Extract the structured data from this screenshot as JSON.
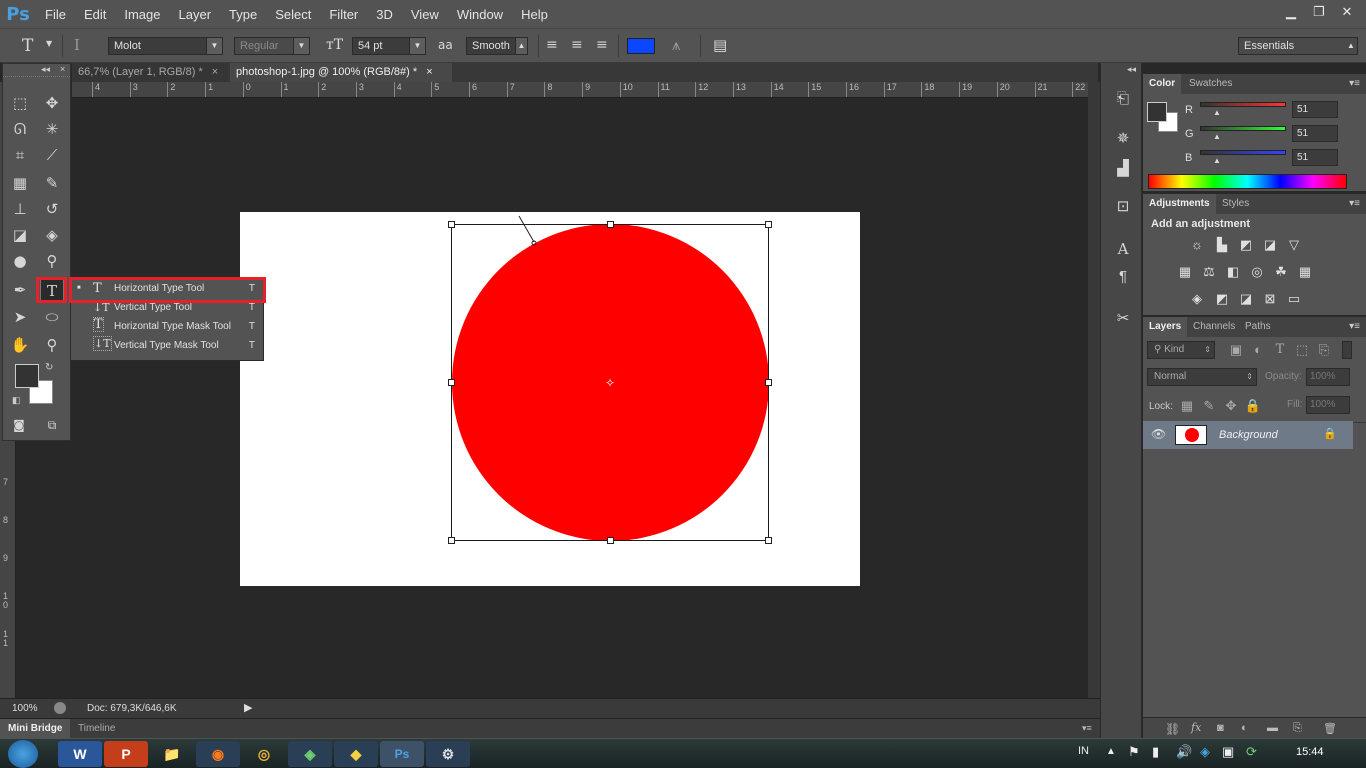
{
  "app": {
    "logo": "Ps"
  },
  "menu": [
    "File",
    "Edit",
    "Image",
    "Layer",
    "Type",
    "Select",
    "Filter",
    "3D",
    "View",
    "Window",
    "Help"
  ],
  "window_controls": {
    "minimize": "▁",
    "restore": "❐",
    "close": "✕"
  },
  "options": {
    "font_family": "Molot",
    "font_style": "Regular",
    "font_size": "54 pt",
    "anti_alias": "Smooth",
    "text_color": "#0a47ff",
    "workspace": "Essentials",
    "aa_label": "aa",
    "tool_icon": "T"
  },
  "tabs": [
    {
      "label": "66,7% (Layer 1, RGB/8) *",
      "close": "×"
    },
    {
      "label": "photoshop-1.jpg @ 100% (RGB/8#) *",
      "close": "×"
    }
  ],
  "hruler_ticks": [
    "4",
    "3",
    "2",
    "1",
    "0",
    "1",
    "2",
    "3",
    "4",
    "5",
    "6",
    "7",
    "8",
    "9",
    "10",
    "11",
    "12",
    "13",
    "14",
    "15",
    "16",
    "17",
    "18",
    "19",
    "20",
    "21",
    "22"
  ],
  "vruler_ticks": [
    "7",
    "8",
    "9",
    "1\n0",
    "1\n1"
  ],
  "flyout": {
    "items": [
      {
        "label": "Horizontal Type Tool",
        "key": "T",
        "icon": "T",
        "selected": true
      },
      {
        "label": "Vertical Type Tool",
        "key": "T",
        "icon": "↓T",
        "selected": false
      },
      {
        "label": "Horizontal Type Mask Tool",
        "key": "T",
        "icon": "T",
        "selected": false
      },
      {
        "label": "Vertical Type Mask Tool",
        "key": "T",
        "icon": "↓T",
        "selected": false
      }
    ],
    "bullet": "■"
  },
  "status": {
    "zoom": "100%",
    "doc": "Doc: 679,3K/646,6K",
    "arrow": "▶"
  },
  "bottom_tabs": [
    "Mini Bridge",
    "Timeline"
  ],
  "color_panel": {
    "tabs": [
      "Color",
      "Swatches"
    ],
    "channels": [
      {
        "label": "R",
        "value": "51"
      },
      {
        "label": "G",
        "value": "51"
      },
      {
        "label": "B",
        "value": "51"
      }
    ]
  },
  "adjustments_panel": {
    "tabs": [
      "Adjustments",
      "Styles"
    ],
    "heading": "Add an adjustment"
  },
  "layers_panel": {
    "tabs": [
      "Layers",
      "Channels",
      "Paths"
    ],
    "kind": "Kind",
    "blend_mode": "Normal",
    "opacity_label": "Opacity:",
    "opacity_value": "100%",
    "lock_label": "Lock:",
    "fill_label": "Fill:",
    "fill_value": "100%",
    "layers": [
      {
        "name": "Background"
      }
    ]
  },
  "taskbar": {
    "lang": "IN",
    "time": "15:44",
    "apps": [
      "W",
      "P",
      "📁",
      "◉",
      "◎",
      "◈",
      "◆",
      "Ps",
      "⚙"
    ]
  },
  "colors": {
    "circle": "#ff0000",
    "highlight": "#e8202a",
    "fg": "#333333",
    "bg": "#ffffff"
  }
}
